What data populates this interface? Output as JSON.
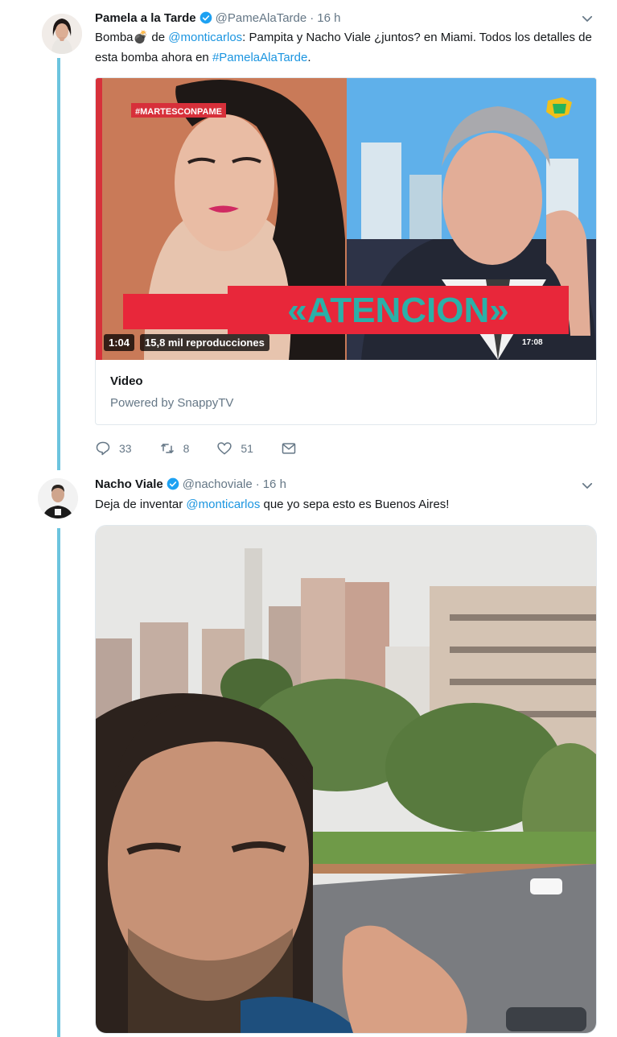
{
  "tweets": [
    {
      "name": "Pamela a la Tarde",
      "handle": "@PameAlaTarde",
      "separator": "·",
      "time": "16 h",
      "text_1": "Bomba",
      "text_bomb": "💣",
      "text_2": " de ",
      "mention": "@monticarlos",
      "text_3": ": Pampita y Nacho Viale ¿juntos? en Miami. Todos los detalles de esta bomba ahora en ",
      "hashtag": "#PamelaAlaTarde",
      "text_4": ".",
      "card": {
        "overlay_tag": "#MARTESCONPAME",
        "banner_text": "«ATENCION»",
        "duration": "1:04",
        "views": "15,8 mil reproducciones",
        "clock": "17:08",
        "title": "Video",
        "powered_by": "Powered by SnappyTV"
      },
      "actions": {
        "replies": "33",
        "retweets": "8",
        "likes": "51"
      }
    },
    {
      "name": "Nacho Viale",
      "handle": "@nachoviale",
      "separator": "·",
      "time": "16 h",
      "text_1": "Deja de inventar ",
      "mention": "@monticarlos",
      "text_2": " que yo sepa esto es Buenos Aires!"
    }
  ],
  "colors": {
    "thread_line": "#6cc4de",
    "link": "#1b95e0",
    "verified": "#1da1f2",
    "banner_red": "#e8273a",
    "banner_text": "#2bb0a8"
  },
  "icons": [
    "verified-icon",
    "chevron-down-icon",
    "reply-icon",
    "retweet-icon",
    "like-icon",
    "message-icon"
  ]
}
